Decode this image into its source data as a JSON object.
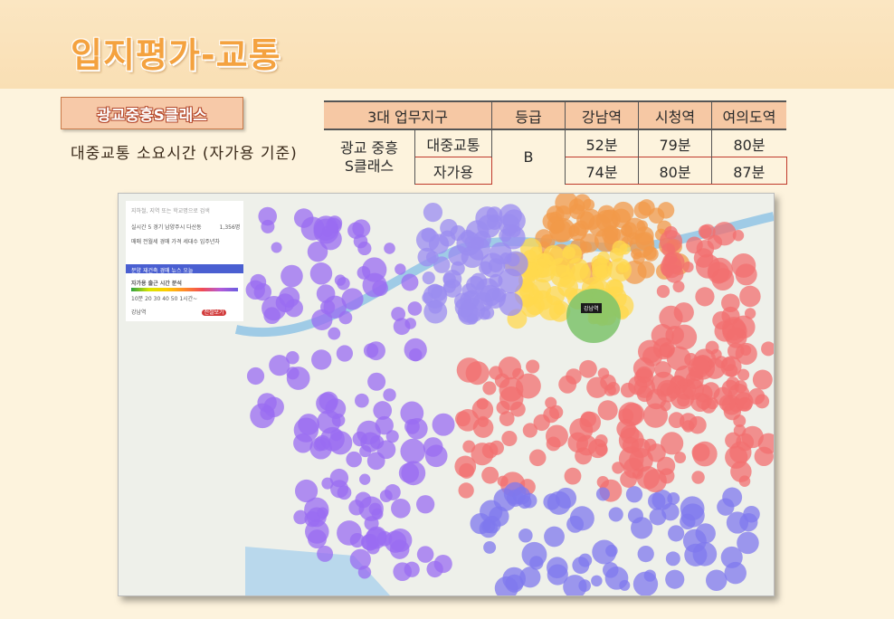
{
  "page": {
    "title": "입지평가-교통"
  },
  "project": {
    "name": "광교중흥S클래스",
    "subtitle": "대중교통  소요시간 (자가용 기준)"
  },
  "table": {
    "headers": [
      "3대 업무지구",
      "등급",
      "강남역",
      "시청역",
      "여의도역"
    ],
    "row_label": "광교 중흥 S클래스",
    "grade": "B",
    "rows": [
      {
        "mode": "대중교통",
        "gangnam": "52분",
        "cityhall": "79분",
        "yeouido": "80분"
      },
      {
        "mode": "자가용",
        "gangnam": "74분",
        "cityhall": "80분",
        "yeouido": "87분"
      }
    ]
  },
  "map": {
    "search_placeholder": "지하철, 지역 또는 학교명으로 검색",
    "route_info": "실시간 5 경기 남양주시 다산동",
    "route_count": "1,356명",
    "tabs": [
      "매매",
      "전월세",
      "경매",
      "가격",
      "세대수",
      "입주년차"
    ],
    "categories": [
      "분양",
      "재건축",
      "경매",
      "뉴스",
      "오늘"
    ],
    "panel_title": "자가용 출근 시간 분석",
    "legend_labels": [
      "10분",
      "20",
      "30",
      "40",
      "50",
      "1시간~"
    ],
    "destination": "강남역",
    "pin_label": "강남역",
    "badge": "전철보기"
  },
  "colors": {
    "title": "#f4a23f",
    "header_band": "#fbe6c2",
    "table_header": "#f6c8a4",
    "purple": "#9a6cf2",
    "coral": "#f26f6f"
  }
}
